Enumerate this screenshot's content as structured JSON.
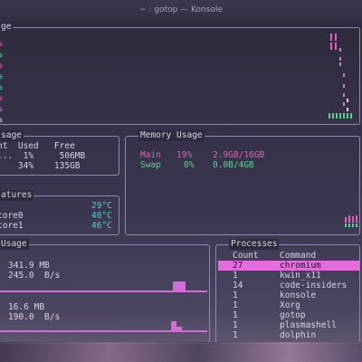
{
  "window": {
    "title": "~ : gotop — Konsole"
  },
  "cpu": {
    "title": "ge",
    "core_pct_labels": [
      "%",
      "%",
      "%",
      "%",
      "%",
      "%",
      "%",
      "%"
    ],
    "core_colors": [
      "#e060b8",
      "#5fd08a",
      "#e060b8",
      "#4fd2d2",
      "#4fd2d2",
      "#e060b8",
      "#c97ed0",
      "#d8d4e4"
    ]
  },
  "disk": {
    "title": "sage",
    "header": "nt  Used   Free",
    "rows": [
      "...  1%     506MB",
      "    34%    135GB"
    ]
  },
  "memory": {
    "title": "Memory Usage",
    "main": {
      "label": "Main",
      "pct": "19%",
      "value": "2.9GB/16GB"
    },
    "swap": {
      "label": "Swap",
      "pct": "0%",
      "value": "0.0B/4GB"
    }
  },
  "temps": {
    "title": "atures",
    "rows": [
      {
        "label": "",
        "value": "29°C"
      },
      {
        "label": "core0",
        "value": "40°C"
      },
      {
        "label": "core1",
        "value": "46°C"
      }
    ]
  },
  "network": {
    "title": "Usage",
    "rx_total": "341.9 MB",
    "rx_rate": "245.0  B/s",
    "tx_total": "16.6 MB",
    "tx_rate": "190.0  B/s"
  },
  "processes": {
    "title": "Processes",
    "col_count": "Count",
    "col_command": "Command",
    "rows": [
      {
        "count": "27",
        "command": "chromium"
      },
      {
        "count": "1",
        "command": "kwin_x11"
      },
      {
        "count": "14",
        "command": "code-insiders"
      },
      {
        "count": "1",
        "command": "konsole"
      },
      {
        "count": "1",
        "command": "Xorg"
      },
      {
        "count": "1",
        "command": "gotop"
      },
      {
        "count": "1",
        "command": "plasmashell"
      },
      {
        "count": "1",
        "command": "dolphin"
      }
    ]
  }
}
